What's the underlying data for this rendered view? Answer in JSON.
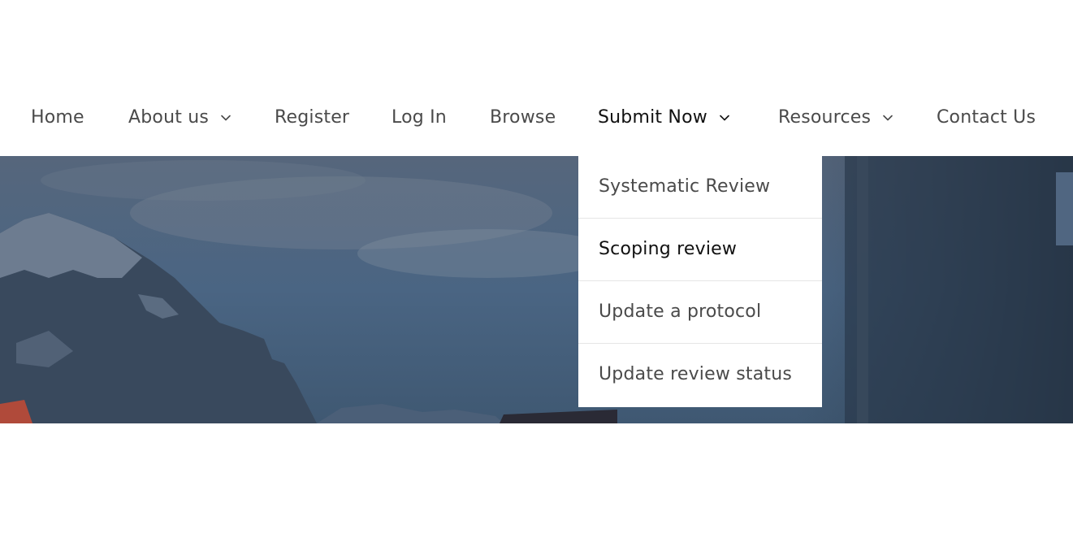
{
  "nav": {
    "items": [
      {
        "label": "Home",
        "has_dropdown": false
      },
      {
        "label": "About us",
        "has_dropdown": true
      },
      {
        "label": "Register",
        "has_dropdown": false
      },
      {
        "label": "Log In",
        "has_dropdown": false
      },
      {
        "label": "Browse",
        "has_dropdown": false
      },
      {
        "label": "Submit Now",
        "has_dropdown": true,
        "active": true
      },
      {
        "label": "Resources",
        "has_dropdown": true
      },
      {
        "label": "Contact Us",
        "has_dropdown": false
      }
    ]
  },
  "submit_menu": {
    "items": [
      {
        "label": "Systematic Review"
      },
      {
        "label": "Scoping review",
        "hovered": true
      },
      {
        "label": "Update a protocol"
      },
      {
        "label": "Update review status"
      }
    ]
  },
  "colors": {
    "nav_text": "#4a4a4a",
    "nav_active": "#111111",
    "hero_overlay": "#3e5066"
  },
  "icons": {
    "dropdown_chevron": "chevron-down-icon"
  }
}
